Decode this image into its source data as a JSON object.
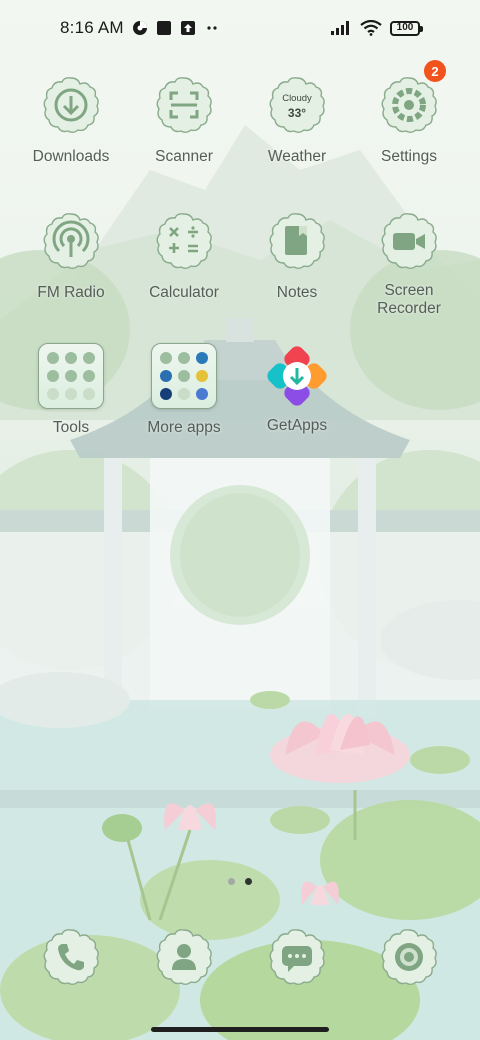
{
  "status_bar": {
    "time": "8:16 AM",
    "battery": "100",
    "icons": [
      "data-saver-icon",
      "app-notification-icon",
      "upload-icon",
      "more-notifications-icon",
      "signal-icon",
      "wifi-icon",
      "battery-icon"
    ]
  },
  "apps": [
    {
      "label": "Downloads",
      "icon": "download-icon"
    },
    {
      "label": "Scanner",
      "icon": "scan-icon"
    },
    {
      "label": "Weather",
      "icon": "weather-icon",
      "condition": "Cloudy",
      "temp": "33°"
    },
    {
      "label": "Settings",
      "icon": "gear-icon",
      "badge": "2"
    },
    {
      "label": "FM Radio",
      "icon": "radio-icon"
    },
    {
      "label": "Calculator",
      "icon": "calculator-icon"
    },
    {
      "label": "Notes",
      "icon": "notes-icon"
    },
    {
      "label": "Screen\nRecorder",
      "label_line1": "Screen",
      "label_line2": "Recorder",
      "icon": "video-camera-icon"
    },
    {
      "label": "Tools",
      "icon": "folder-icon"
    },
    {
      "label": "More apps",
      "icon": "folder-icon"
    },
    {
      "label": "GetApps",
      "icon": "getapps-icon"
    }
  ],
  "dock": [
    {
      "icon": "phone-icon"
    },
    {
      "icon": "contacts-icon"
    },
    {
      "icon": "messages-icon"
    },
    {
      "icon": "camera-icon"
    }
  ],
  "page_indicator": {
    "pages": 2,
    "current": 2
  },
  "colors": {
    "icon_green": "#7fa583",
    "icon_bg": "#e4f0e3",
    "badge": "#f2521c",
    "label": "#555d58"
  }
}
